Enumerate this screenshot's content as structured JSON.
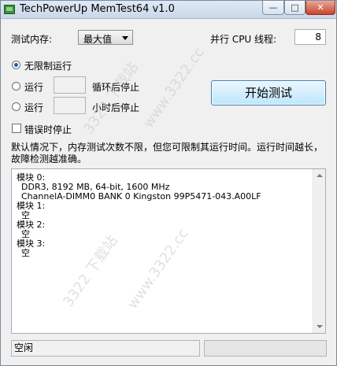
{
  "window": {
    "title": "TechPowerUp MemTest64 v1.0",
    "controls": {
      "minimize": "—",
      "maximize": "□",
      "close": "✕"
    }
  },
  "settings": {
    "memory_label": "测试内存:",
    "memory_value": "最大值",
    "threads_label": "并行 CPU 线程:",
    "threads_value": "8"
  },
  "run_mode": {
    "unlimited_label": "无限制运行",
    "loops_run_label": "运行",
    "loops_suffix": "循环后停止",
    "hours_run_label": "运行",
    "hours_suffix": "小时后停止",
    "selected": "unlimited"
  },
  "start_button": "开始测试",
  "stop_on_error_label": "错误时停止",
  "description": "默认情况下，内存测试次数不限，但您可限制其运行时间。运行时间越长，故障检测越准确。",
  "modules": [
    {
      "header": "模块 0:",
      "lines": [
        "DDR3, 8192 MB, 64-bit, 1600 MHz",
        "ChannelA-DIMM0 BANK 0 Kingston 99P5471-043.A00LF"
      ]
    },
    {
      "header": "模块 1:",
      "lines": [
        "空"
      ]
    },
    {
      "header": "模块 2:",
      "lines": [
        "空"
      ]
    },
    {
      "header": "模块 3:",
      "lines": [
        "空"
      ]
    }
  ],
  "status": {
    "text": "空闲",
    "progress": 0
  },
  "colors": {
    "accent": "#1d5fa8",
    "progress": "#06b025"
  }
}
